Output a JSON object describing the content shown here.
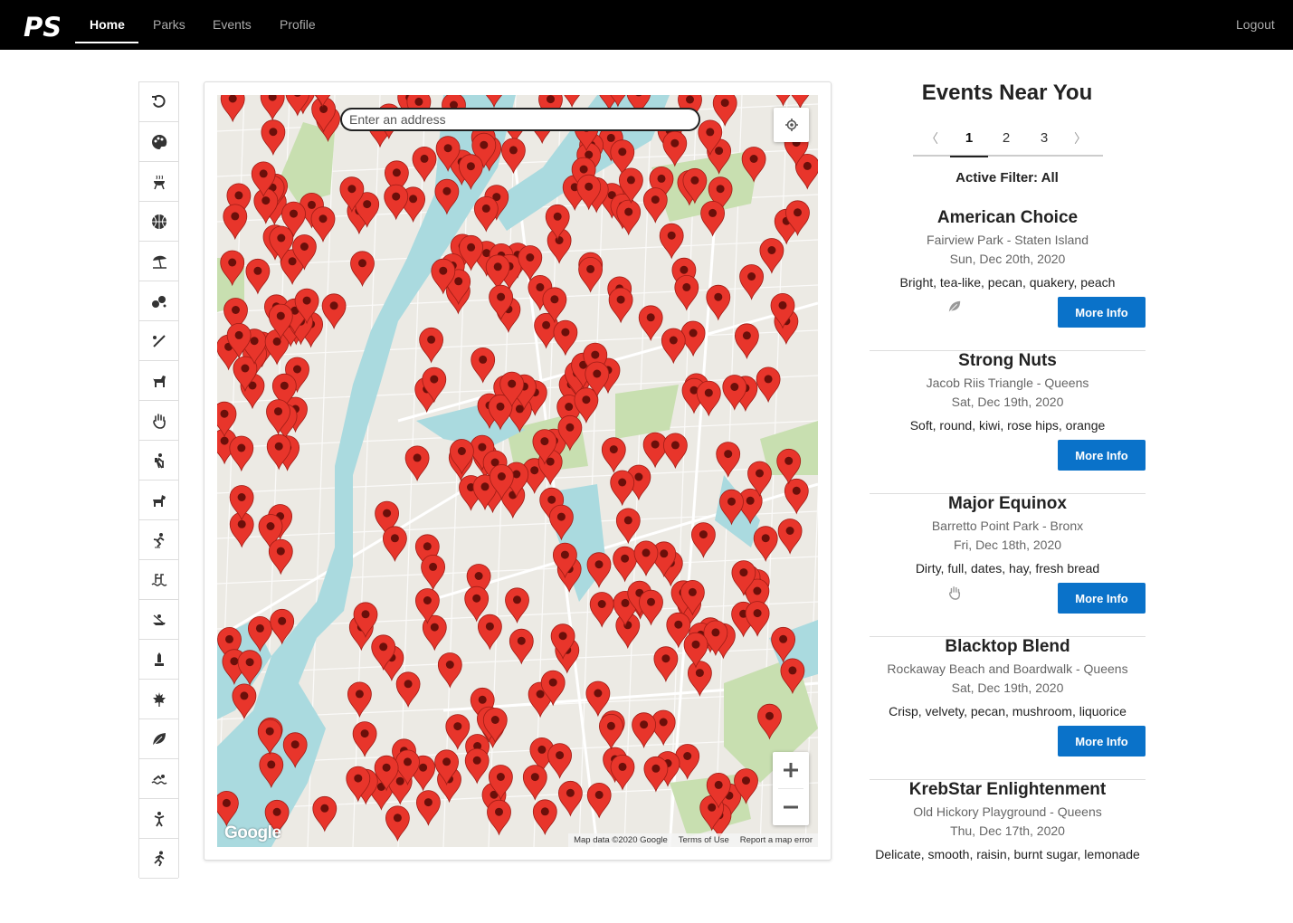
{
  "nav": {
    "logo": "PS",
    "items": [
      {
        "label": "Home",
        "active": true
      },
      {
        "label": "Parks",
        "active": false
      },
      {
        "label": "Events",
        "active": false
      },
      {
        "label": "Profile",
        "active": false
      }
    ],
    "logout": "Logout"
  },
  "toolbar": {
    "icons": [
      "undo-icon",
      "palette-icon",
      "bbq-grill-icon",
      "basketball-icon",
      "beach-umbrella-icon",
      "bocce-icon",
      "baseball-bat-icon",
      "dog-icon",
      "hand-icon",
      "hiking-icon",
      "horse-icon",
      "ice-skating-icon",
      "pool-icon",
      "kayak-icon",
      "bell-icon",
      "maple-leaf-icon",
      "leaf-icon",
      "swimming-icon",
      "playground-icon",
      "running-icon"
    ]
  },
  "map": {
    "search_placeholder": "Enter an address",
    "google_label": "Google",
    "attribution": {
      "data": "Map data ©2020 Google",
      "terms": "Terms of Use",
      "report": "Report a map error"
    },
    "marker_color": "#e8352b"
  },
  "events": {
    "title": "Events Near You",
    "pages": [
      "1",
      "2",
      "3"
    ],
    "active_page": "1",
    "filter_label": "Active Filter: All",
    "more_label": "More Info",
    "items": [
      {
        "name": "American Choice",
        "park": "Fairview Park - Staten Island",
        "date": "Sun, Dec 20th, 2020",
        "desc": "Bright, tea-like, pecan, quakery, peach",
        "icon": "leaf-icon"
      },
      {
        "name": "Strong Nuts",
        "park": "Jacob Riis Triangle - Queens",
        "date": "Sat, Dec 19th, 2020",
        "desc": "Soft, round, kiwi, rose hips, orange",
        "icon": ""
      },
      {
        "name": "Major Equinox",
        "park": "Barretto Point Park - Bronx",
        "date": "Fri, Dec 18th, 2020",
        "desc": "Dirty, full, dates, hay, fresh bread",
        "icon": "hand-icon"
      },
      {
        "name": "Blacktop Blend",
        "park": "Rockaway Beach and Boardwalk - Queens",
        "date": "Sat, Dec 19th, 2020",
        "desc": "Crisp, velvety, pecan, mushroom, liquorice",
        "icon": ""
      },
      {
        "name": "KrebStar Enlightenment",
        "park": "Old Hickory Playground - Queens",
        "date": "Thu, Dec 17th, 2020",
        "desc": "Delicate, smooth, raisin, burnt sugar, lemonade",
        "icon": ""
      }
    ]
  },
  "colors": {
    "nav_bg": "#000000",
    "button_blue": "#0a72c9",
    "water": "#aadadf",
    "park_green": "#c8dfb0",
    "land": "#eceae4"
  }
}
